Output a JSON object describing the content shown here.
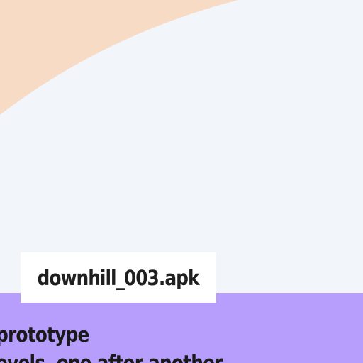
{
  "colors": {
    "background": "#f2f5fa",
    "blob": "#f8dbc5",
    "tag_background": "#ffffff",
    "panel_background": "#b79efd",
    "text": "#1f1f1f"
  },
  "file_tag": {
    "filename": "downhill_003.apk"
  },
  "caption": {
    "line1": "prototype",
    "line2": "evels, one after another"
  }
}
